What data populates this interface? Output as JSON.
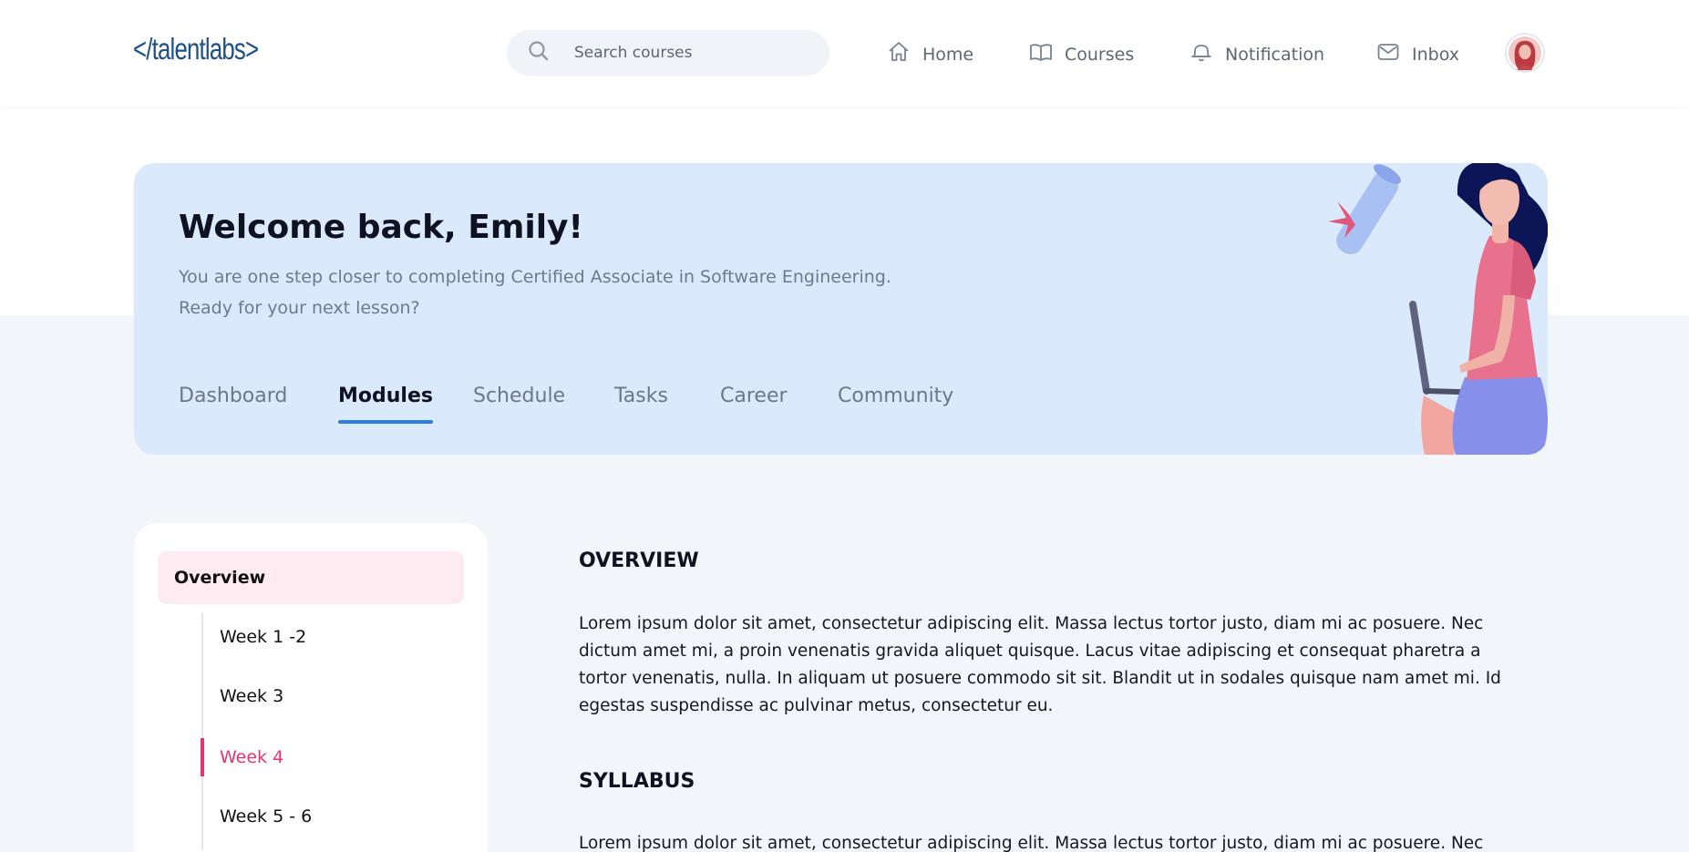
{
  "header": {
    "logo_text": "</talentlabs>",
    "search_placeholder": "Search courses",
    "nav": [
      {
        "label": "Home",
        "icon": "home-icon"
      },
      {
        "label": "Courses",
        "icon": "book-icon"
      },
      {
        "label": "Notification",
        "icon": "bell-icon"
      },
      {
        "label": "Inbox",
        "icon": "mail-icon"
      }
    ],
    "avatar_icon": "user-avatar"
  },
  "banner": {
    "welcome": "Welcome back, Emily!",
    "subtitle_line1": "You are one step closer to completing Certified Associate in Software Engineering.",
    "subtitle_line2": "Ready for your next lesson?",
    "tabs": [
      "Dashboard",
      "Modules",
      "Schedule",
      "Tasks",
      "Career",
      "Community"
    ],
    "active_tab": "Modules"
  },
  "sidebar": {
    "overview": "Overview",
    "items": [
      "Week 1 -2",
      "Week 3",
      "Week 4",
      "Week 5 - 6"
    ],
    "active_item": "Week 4"
  },
  "content": {
    "overview_title": "OVERVIEW",
    "overview_text": "Lorem ipsum dolor sit amet, consectetur adipiscing elit. Massa lectus tortor justo, diam mi ac posuere. Nec dictum amet mi, a proin venenatis gravida aliquet quisque. Lacus vitae adipiscing et consequat pharetra a tortor venenatis, nulla. In aliquam ut posuere commodo sit sit. Blandit ut in sodales quisque nam amet mi. Id egestas suspendisse ac pulvinar metus, consectetur eu.",
    "syllabus_title": "SYLLABUS",
    "syllabus_text": "Lorem ipsum dolor sit amet, consectetur adipiscing elit. Massa lectus tortor justo, diam mi ac posuere. Nec"
  },
  "colors": {
    "brand": "#1d4f8a",
    "accent_blue": "#2b7de9",
    "accent_pink": "#e8336e",
    "banner_bg": "#dbe9fc",
    "page_bg": "#f2f5f9"
  }
}
